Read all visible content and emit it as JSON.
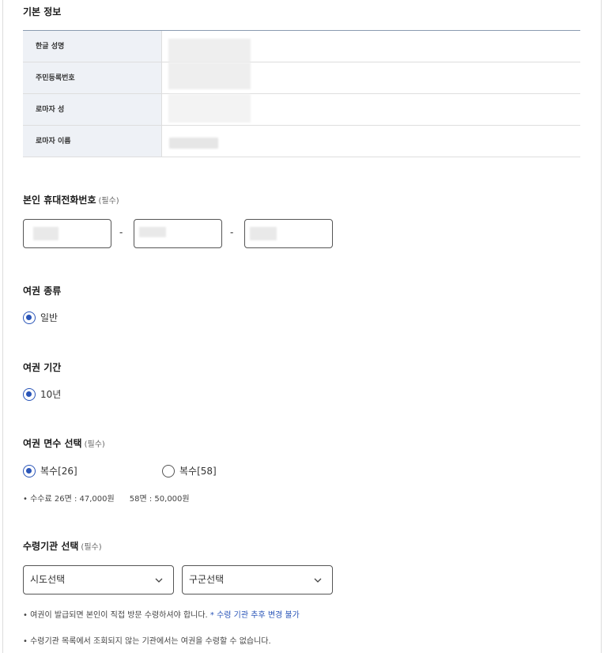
{
  "basic_info": {
    "title": "기본 정보",
    "rows": [
      {
        "label": "한글 성명"
      },
      {
        "label": "주민등록번호"
      },
      {
        "label": "로마자 성"
      },
      {
        "label": "로마자 이름"
      }
    ]
  },
  "phone": {
    "title": "본인 휴대전화번호",
    "required": "(필수)",
    "separator": "-"
  },
  "passport_type": {
    "title": "여권 종류",
    "options": [
      {
        "label": "일반",
        "selected": true
      }
    ]
  },
  "passport_period": {
    "title": "여권 기간",
    "options": [
      {
        "label": "10년",
        "selected": true
      }
    ]
  },
  "passport_pages": {
    "title": "여권 면수 선택",
    "required": "(필수)",
    "options": [
      {
        "label": "복수[26]",
        "selected": true
      },
      {
        "label": "복수[58]",
        "selected": false
      }
    ],
    "fee_note": "• 수수료 26면 : 47,000원      58면 : 50,000원"
  },
  "receiving_office": {
    "title": "수령기관 선택",
    "required": "(필수)",
    "city_select": "시도선택",
    "district_select": "구군선택",
    "note1": "• 여권이 발급되면 본인이 직접 방문 수령하셔야 합니다.",
    "note1_highlight": "* 수령 기관 추후 변경 불가",
    "note2": "• 수령기관 목록에서 조회되지 않는 기관에서는 여권을 수령할 수 없습니다."
  },
  "icons": {
    "select_arrow": "chevron-down-icon"
  },
  "colors": {
    "accent": "#2a55b8",
    "table_label_bg": "#eef1f6",
    "table_border_top": "#8a9bb0"
  }
}
